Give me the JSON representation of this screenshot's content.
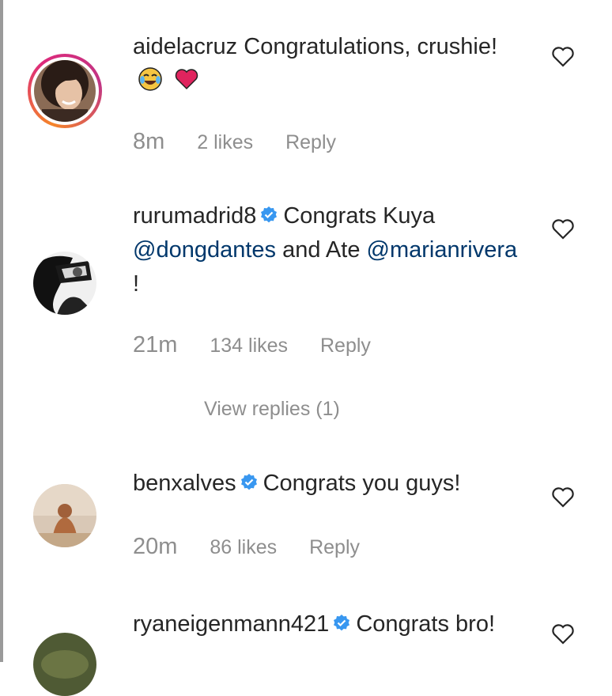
{
  "comments": [
    {
      "username": "aidelacruz",
      "text": "Congratulations, crushie!",
      "verified": false,
      "time": "8m",
      "likes": "2 likes",
      "reply": "Reply",
      "emojis": [
        "tears-of-joy-emoji",
        "red-heart-emoji"
      ]
    },
    {
      "username": "rurumadrid8",
      "verified": true,
      "text_parts": [
        "Congrats Kuya",
        "@dongdantes",
        "and Ate",
        "@marianrivera",
        "!"
      ],
      "time": "21m",
      "likes": "134 likes",
      "reply": "Reply",
      "view_replies": "View replies (1)"
    },
    {
      "username": "benxalves",
      "verified": true,
      "text": "Congrats you guys!",
      "time": "20m",
      "likes": "86 likes",
      "reply": "Reply"
    },
    {
      "username": "ryaneigenmann421",
      "verified": true,
      "text": "Congrats bro!"
    }
  ],
  "colors": {
    "text": "#262626",
    "muted": "#8e8e8e",
    "mention": "#00376b",
    "verified": "#3897f0"
  }
}
